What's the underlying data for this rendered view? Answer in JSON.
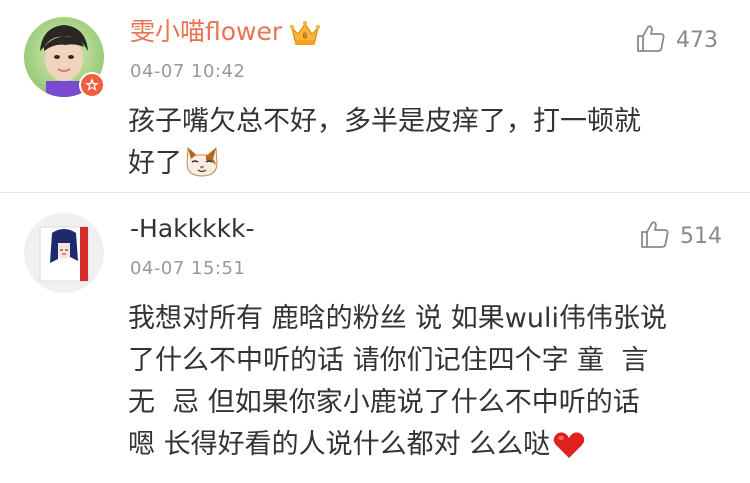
{
  "comments": [
    {
      "username": "雯小喵flower",
      "timestamp": "04-07 10:42",
      "like_count": "473",
      "text_lines": [
        "孩子嘴欠总不好，多半是皮痒了，打一顿就",
        "好了"
      ],
      "emoji": "cat-face",
      "badges": [
        "verified-badge",
        "crown-icon"
      ]
    },
    {
      "username": "-Hakkkkk-",
      "timestamp": "04-07 15:51",
      "like_count": "514",
      "text_lines": [
        "我想对所有 鹿晗的粉丝 说 如果wuli伟伟张说",
        "了什么不中听的话 请你们记住四个字 童  言",
        "无  忌 但如果你家小鹿说了什么不中听的话",
        "嗯 长得好看的人说什么都对 么么哒"
      ],
      "emoji": "red-heart"
    }
  ],
  "colors": {
    "vip_username": "#eb7350",
    "username": "#333333",
    "meta": "#999999",
    "divider": "#e4e4e4"
  }
}
